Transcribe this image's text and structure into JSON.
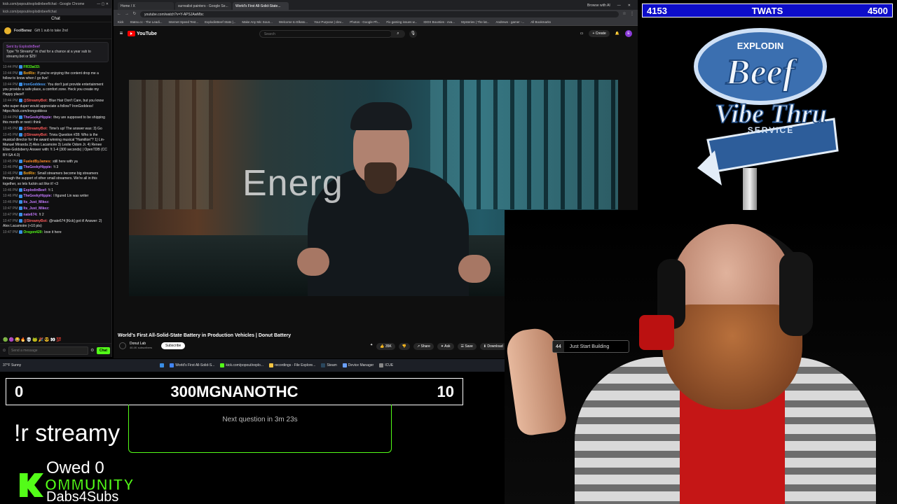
{
  "chat_window": {
    "title": "kick.com/popout/explodinbeef/chat - Google Chrome",
    "url": "kick.com/popout/explodinbeef/chat",
    "header": "Chat",
    "gift_user": "FoolBanaz",
    "gift_text": "Gift 1 sub to take 2nd",
    "pinned_by": "Sent by ExplodinBeef",
    "pinned_text": "Type \"!lr Streamy\" in chat for a chance at a year sub to streamy.bot or $25!",
    "messages": [
      {
        "time": "10:44 PM",
        "user": "FR33at33:",
        "color": "#53fc18",
        "text": ""
      },
      {
        "time": "10:44 PM",
        "user": "BotRix:",
        "color": "#f5a623",
        "text": "If you're enjoying the content drop me a follow to know when I go live!"
      },
      {
        "time": "10:44 PM",
        "user": "IronGoddess:",
        "color": "#4ea3ff",
        "text": "You don't just provide entertainment you provide a safe place, a comfort zone. Heck you create my Happy place!!"
      },
      {
        "time": "10:44 PM",
        "user": "@StreamyBot:",
        "color": "#ff5b5b",
        "text": "Blue Hair Don't Care, but you know who super duper would appreciate a follow? IronGoddess! https://kick.com/irongoddess"
      },
      {
        "time": "10:44 PM",
        "user": "TheGeekyHippie:",
        "color": "#c57bff",
        "text": "they are supposed to be shipping this month or next i think"
      },
      {
        "time": "10:45 PM",
        "user": "@StreamyBot:",
        "color": "#ff5b5b",
        "text": "Time's up! The answer was: 3) Go"
      },
      {
        "time": "10:45 PM",
        "user": "@StreamyBot:",
        "color": "#ff5b5b",
        "text": "Trivia Question #28: Who is the musical director for the award winning musical \"Hamilton\"? 1) Lin-Manuel Miranda 2) Alex Lacamoire 3) Leslie Odom Jr. 4) Renee Elise-Goldsberry Answer with: !t 1-4 (300 seconds) | OpenTDB (CC BY-SA 4.0)"
      },
      {
        "time": "10:45 PM",
        "user": "FueledByJames:",
        "color": "#ff8a2a",
        "text": "still here with ya"
      },
      {
        "time": "10:46 PM",
        "user": "TheGeekyHippie:",
        "color": "#c57bff",
        "text": "!t 3"
      },
      {
        "time": "10:46 PM",
        "user": "BotRix:",
        "color": "#f5a623",
        "text": "Small streamers become big streamers through the support of other small streamers. We're all in this together, so lets fuckin act like it! <3"
      },
      {
        "time": "10:46 PM",
        "user": "ExplodinBeef:",
        "color": "#c57bff",
        "text": "!t 1"
      },
      {
        "time": "10:46 PM",
        "user": "TheGeekyHippie:",
        "color": "#c57bff",
        "text": "I figured Lin was writer"
      },
      {
        "time": "10:46 PM",
        "user": "Its_Just_Mikez:",
        "color": "#c57bff",
        "text": ""
      },
      {
        "time": "10:47 PM",
        "user": "Its_Just_Mikez:",
        "color": "#c57bff",
        "text": ""
      },
      {
        "time": "10:47 PM",
        "user": "nate674:",
        "color": "#c57bff",
        "text": "!t 2"
      },
      {
        "time": "10:47 PM",
        "user": "@StreamyBot:",
        "color": "#ff5b5b",
        "text": "@nate674 [Kick] got it! Answer: 2) Alex Lacamoire (+10 pts)"
      },
      {
        "time": "10:47 PM",
        "user": "Oregon420:",
        "color": "#53fc18",
        "text": "love it here"
      }
    ],
    "input_placeholder": "Send a message",
    "chat_button": "Chat",
    "emotes": "🟢🟣😂🔥💀🐸🎉😎👀💯"
  },
  "browser": {
    "tabs": [
      "Home / X",
      "surrealist painters - Google Se...",
      "World's First All-Solid-State..."
    ],
    "tabbar_right": [
      "Browse with AI",
      "—",
      "✕"
    ],
    "url": "youtube.com/watch?v=Y-APSJAwMbc",
    "bookmarks": [
      "Kick",
      "Statsx.cc - The Leadi...",
      "Internet Speed Test...",
      "ExplodinBeef Stats |...",
      "Make Any Mic Soun...",
      "Welcome to Elkato...",
      "Your Purpose | clev...",
      "Photos - Google Ph...",
      "Fix gaming issues w...",
      "IDOX Bounties - eva...",
      "Mysteries | The lat...",
      "Andrews - gamer -...",
      "All Bookmarks"
    ],
    "yt_brand": "YouTube",
    "search_placeholder": "Search",
    "create_label": "+ Create",
    "avatar_letter": "E",
    "video_overlay_text": "Energ",
    "video_title": "World's First All-Solid-State Battery in Production Vehicles | Donut Battery",
    "channel_name": "Donut Lab",
    "channel_subs": "46.4K subscribers",
    "subscribe_label": "Subscribe",
    "actions": [
      "👍 35K",
      "👎",
      "↗ Share",
      "✦ Ask",
      "☰ Save",
      "⬇ Download"
    ]
  },
  "taskbar": {
    "weather": "37°F Sunny",
    "apps": [
      {
        "label": "World's First All-Solid-S...",
        "color": "#4285f4"
      },
      {
        "label": "kick.com/popout/explo...",
        "color": "#53fc18"
      },
      {
        "label": "recordings - File Explore...",
        "color": "#f5c542"
      },
      {
        "label": "Steam",
        "color": "#2a475e"
      },
      {
        "label": "Device Manager",
        "color": "#6aa0ff"
      },
      {
        "label": "ICUE",
        "color": "#888"
      }
    ]
  },
  "overlay": {
    "top_left_score": "4153",
    "top_title": "TWATS",
    "top_right_score": "4500",
    "logo_top": "EXPLODIN",
    "logo_main": "Beef",
    "logo_sub": "Vibe Thru",
    "logo_service": "SERVICE",
    "bottom_left_score": "0",
    "bottom_title": "300MGNANOTHC",
    "bottom_right_score": "10",
    "command_text": "!r streamy",
    "next_question": "Next question in 3m 23s",
    "owed": "Owed 0",
    "community": "OMMUNITY",
    "dabs": "Dabs4Subs",
    "just_start_number": "44",
    "just_start_label": "Just Start Building"
  }
}
